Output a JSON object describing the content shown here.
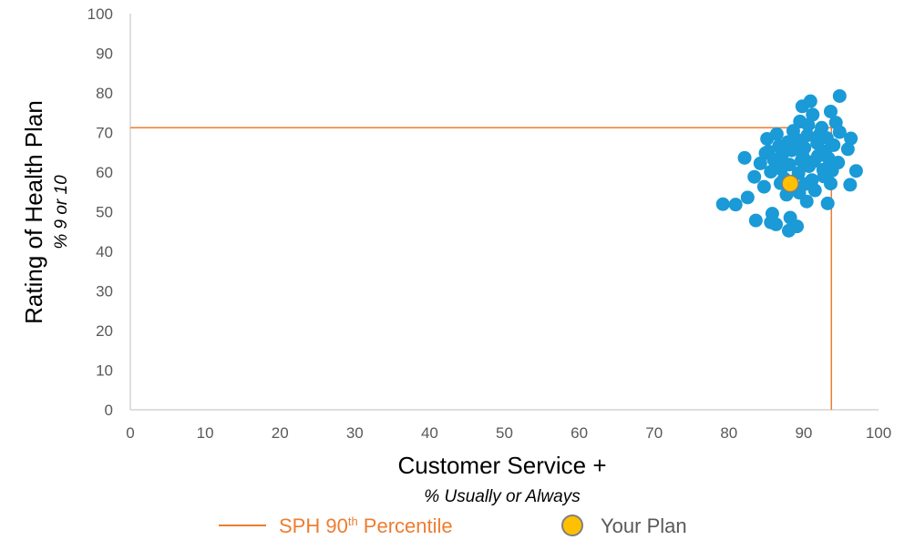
{
  "colors": {
    "plan_dots": "#1a9ad6",
    "your_plan_fill": "#ffc000",
    "your_plan_stroke": "#7f7f7f",
    "percentile_line": "#ed7d31",
    "axis": "#bfbfbf"
  },
  "chart_data": {
    "type": "scatter",
    "xlabel": "Customer Service +",
    "xlabel_sub": "% Usually or Always",
    "ylabel": "Rating of Health Plan",
    "ylabel_sub": "% 9 or 10",
    "xlim": [
      0,
      100
    ],
    "ylim": [
      0,
      100
    ],
    "xticks": [
      0,
      10,
      20,
      30,
      40,
      50,
      60,
      70,
      80,
      90,
      100
    ],
    "yticks": [
      0,
      10,
      20,
      30,
      40,
      50,
      60,
      70,
      80,
      90,
      100
    ],
    "grid": false,
    "legend_position": "bottom",
    "series": [
      {
        "marker": "plan-dot",
        "points": [
          [
            94.8,
            79.2
          ],
          [
            90.9,
            77.9
          ],
          [
            89.8,
            76.6
          ],
          [
            93.6,
            75.3
          ],
          [
            91.2,
            74.5
          ],
          [
            89.5,
            72.8
          ],
          [
            94.3,
            72.5
          ],
          [
            92.4,
            71.2
          ],
          [
            88.6,
            70.4
          ],
          [
            94.8,
            70.1
          ],
          [
            86.4,
            69.6
          ],
          [
            90.5,
            69.3
          ],
          [
            93.1,
            68.6
          ],
          [
            85.1,
            68.4
          ],
          [
            89.2,
            68.1
          ],
          [
            96.3,
            68.5
          ],
          [
            87.9,
            67.6
          ],
          [
            91.8,
            67.3
          ],
          [
            94.0,
            66.8
          ],
          [
            86.7,
            66.6
          ],
          [
            90.1,
            66.1
          ],
          [
            95.9,
            65.8
          ],
          [
            88.4,
            65.5
          ],
          [
            92.9,
            65.2
          ],
          [
            84.9,
            64.8
          ],
          [
            87.1,
            64.3
          ],
          [
            89.9,
            63.9
          ],
          [
            93.3,
            63.5
          ],
          [
            82.1,
            63.6
          ],
          [
            86.0,
            63.1
          ],
          [
            91.4,
            62.8
          ],
          [
            94.6,
            62.4
          ],
          [
            84.2,
            62.2
          ],
          [
            88.1,
            61.9
          ],
          [
            90.7,
            61.5
          ],
          [
            86.9,
            60.9
          ],
          [
            92.6,
            60.6
          ],
          [
            97.0,
            60.3
          ],
          [
            85.6,
            60.1
          ],
          [
            89.3,
            59.7
          ],
          [
            83.4,
            58.8
          ],
          [
            87.4,
            58.4
          ],
          [
            91.1,
            58.0
          ],
          [
            90.2,
            57.0
          ],
          [
            84.7,
            56.3
          ],
          [
            93.6,
            57.1
          ],
          [
            96.2,
            56.8
          ],
          [
            88.8,
            55.6
          ],
          [
            87.7,
            54.3
          ],
          [
            82.5,
            53.6
          ],
          [
            91.5,
            55.4
          ],
          [
            90.4,
            52.6
          ],
          [
            93.2,
            52.1
          ],
          [
            79.2,
            51.9
          ],
          [
            80.9,
            51.8
          ],
          [
            85.8,
            49.5
          ],
          [
            83.6,
            47.8
          ],
          [
            88.2,
            48.5
          ],
          [
            85.6,
            47.3
          ],
          [
            86.3,
            46.8
          ],
          [
            89.1,
            46.3
          ],
          [
            88.0,
            45.2
          ],
          [
            86.9,
            57.2
          ],
          [
            89.7,
            62.9
          ],
          [
            91.9,
            64.1
          ],
          [
            92.2,
            69.7
          ],
          [
            90.6,
            71.9
          ],
          [
            93.8,
            60.4
          ],
          [
            89.4,
            54.8
          ],
          [
            87.3,
            61.5
          ],
          [
            85.3,
            65.2
          ],
          [
            92.7,
            58.9
          ]
        ]
      },
      {
        "name": "Your Plan",
        "marker": "your-plan",
        "points": [
          [
            88.2,
            57.1
          ]
        ]
      }
    ],
    "reference_lines": [
      {
        "name": "SPH 90th Percentile",
        "x": 93.7,
        "y": 71.2
      }
    ]
  },
  "legend": {
    "line_label_pre": "SPH 90",
    "line_label_sup": "th",
    "line_label_post": " Percentile",
    "marker_label": "Your Plan"
  }
}
